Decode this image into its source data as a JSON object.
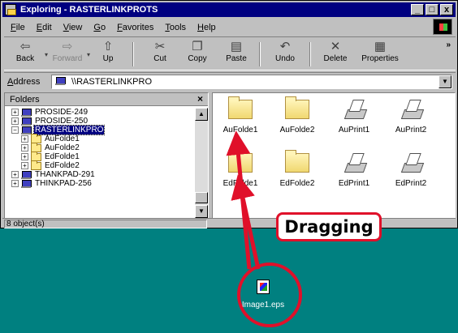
{
  "window": {
    "title": "Exploring - RASTERLINKPROTS",
    "controls": [
      "_",
      "□",
      "x"
    ]
  },
  "menu": [
    "File",
    "Edit",
    "View",
    "Go",
    "Favorites",
    "Tools",
    "Help"
  ],
  "toolbar": {
    "buttons": [
      {
        "label": "Back",
        "icon": "back-arrow-icon",
        "glyph": "⇦"
      },
      {
        "label": "Forward",
        "icon": "forward-arrow-icon",
        "glyph": "⇨"
      },
      {
        "label": "Up",
        "icon": "up-folder-icon",
        "glyph": "⇧"
      },
      {
        "label": "Cut",
        "icon": "scissors-icon",
        "glyph": "✂"
      },
      {
        "label": "Copy",
        "icon": "copy-icon",
        "glyph": "❐"
      },
      {
        "label": "Paste",
        "icon": "paste-icon",
        "glyph": "▤"
      },
      {
        "label": "Undo",
        "icon": "undo-icon",
        "glyph": "↶"
      },
      {
        "label": "Delete",
        "icon": "delete-icon",
        "glyph": "✕"
      },
      {
        "label": "Properties",
        "icon": "properties-icon",
        "glyph": "▦"
      }
    ],
    "more": "»"
  },
  "address": {
    "label": "Address",
    "value": "\\\\RASTERLINKPRO"
  },
  "folders": {
    "title": "Folders",
    "close": "×",
    "tree": [
      {
        "label": "PROSIDE-249",
        "type": "computer",
        "level": 0,
        "expander": "+"
      },
      {
        "label": "PROSIDE-250",
        "type": "computer",
        "level": 0,
        "expander": "+"
      },
      {
        "label": "RASTERLINKPRO",
        "type": "computer",
        "level": 0,
        "expander": "−",
        "selected": true
      },
      {
        "label": "AuFolde1",
        "type": "folder",
        "level": 1,
        "expander": "+"
      },
      {
        "label": "AuFolde2",
        "type": "folder",
        "level": 1,
        "expander": "+"
      },
      {
        "label": "EdFolde1",
        "type": "folder",
        "level": 1,
        "expander": "+"
      },
      {
        "label": "EdFolde2",
        "type": "folder",
        "level": 1,
        "expander": "+"
      },
      {
        "label": "THANKPAD-291",
        "type": "computer",
        "level": 0,
        "expander": "+"
      },
      {
        "label": "THINKPAD-256",
        "type": "computer",
        "level": 0,
        "expander": "+"
      }
    ]
  },
  "content": {
    "items": [
      {
        "label": "AuFolde1",
        "type": "folder"
      },
      {
        "label": "AuFolde2",
        "type": "folder"
      },
      {
        "label": "AuPrint1",
        "type": "printer"
      },
      {
        "label": "AuPrint2",
        "type": "printer"
      },
      {
        "label": "EdFolde1",
        "type": "folder"
      },
      {
        "label": "EdFolde2",
        "type": "folder"
      },
      {
        "label": "EdPrint1",
        "type": "printer"
      },
      {
        "label": "EdPrint2",
        "type": "printer"
      }
    ]
  },
  "status": {
    "text": "8 object(s)"
  },
  "desktop": {
    "file_label": "Image1.eps"
  },
  "annotation": {
    "callout_text": "Dragging",
    "color": "#e0102a"
  },
  "colors": {
    "titlebar": "#000080",
    "desktop": "#008080",
    "chrome": "#c0c0c0"
  }
}
